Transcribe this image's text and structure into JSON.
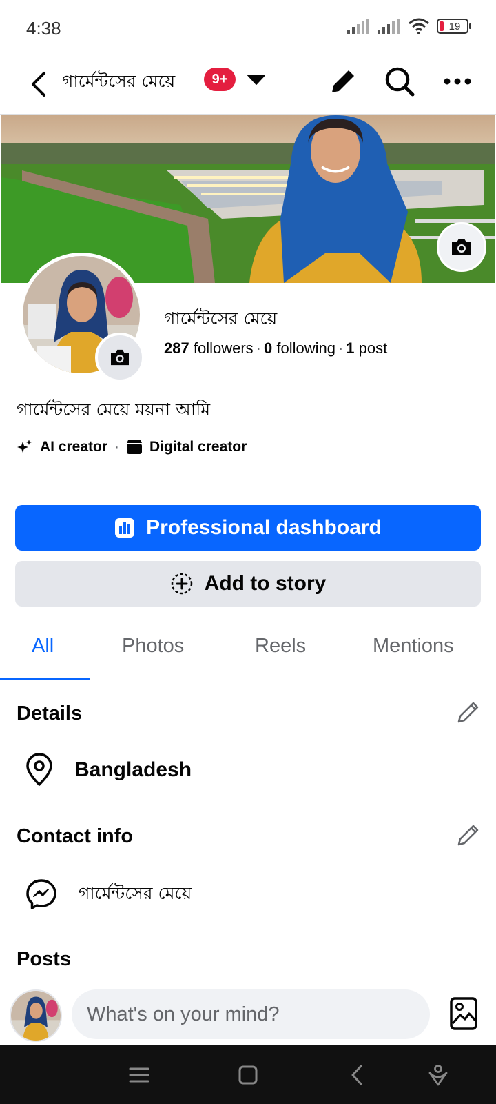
{
  "status_bar": {
    "time": "4:38",
    "battery": "19"
  },
  "header": {
    "title": "গার্মেন্টসের মেয়ে",
    "badge": "9+"
  },
  "profile": {
    "name": "গার্মেন্টসের মেয়ে",
    "followers_count": "287",
    "followers_label": "followers",
    "following_count": "0",
    "following_label": "following",
    "posts_count": "1",
    "posts_label": "post",
    "separator": "·",
    "bio": "গার্মেন্টসের মেয়ে ময়না আমি",
    "categories": [
      "AI creator",
      "Digital creator"
    ]
  },
  "buttons": {
    "professional_dashboard": "Professional dashboard",
    "add_to_story": "Add to story"
  },
  "tabs": [
    "All",
    "Photos",
    "Reels",
    "Mentions"
  ],
  "details": {
    "title": "Details",
    "location": "Bangladesh"
  },
  "contact": {
    "title": "Contact info",
    "messenger": "গার্মেন্টসের মেয়ে"
  },
  "posts": {
    "title": "Posts",
    "composer_placeholder": "What's on your mind?"
  },
  "colors": {
    "primary": "#0866ff",
    "badge": "#e41e3f",
    "secondary_button": "#e4e6eb",
    "muted_text": "#65676b",
    "dress": "#e0a72a",
    "scarf": "#1f5fb3"
  },
  "icons": {
    "status": [
      "signal-icon",
      "signal-icon",
      "wifi-icon",
      "battery-icon"
    ],
    "header": [
      "back-arrow-icon",
      "caret-down-icon",
      "pencil-icon",
      "search-icon",
      "more-icon"
    ],
    "categories": [
      "sparkle-icon",
      "clapperboard-icon"
    ],
    "buttons": [
      "bar-chart-icon",
      "plus-circle-icon"
    ],
    "rows": [
      "location-pin-icon",
      "messenger-icon"
    ],
    "nav": [
      "menu-icon",
      "home-square-icon",
      "back-icon",
      "assistant-icon"
    ]
  }
}
